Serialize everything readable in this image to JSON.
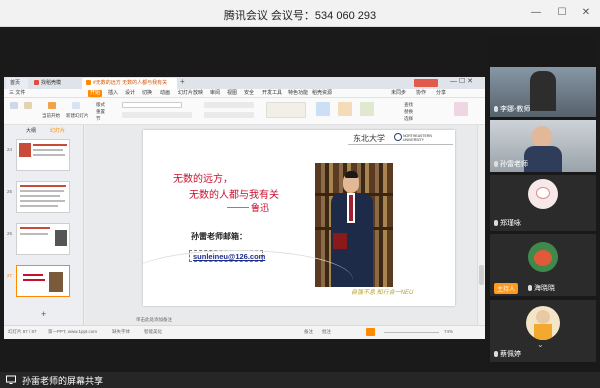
{
  "window": {
    "title": "腾讯会议 会议号：534 060 293",
    "minimize": "—",
    "maximize": "☐",
    "close": "✕"
  },
  "wps": {
    "tabs": [
      {
        "label": "首页",
        "color": "#4a74e6"
      },
      {
        "label": "找稻壳模板",
        "color": "#e24c3f"
      },
      {
        "label": "#无数的远方 无数的人都与我有关#...",
        "color": "#ff8a00"
      }
    ],
    "menus": [
      "三 文件",
      "开始",
      "插入",
      "设计",
      "切换",
      "动画",
      "幻灯片放映",
      "审阅",
      "视图",
      "安全",
      "开发工具",
      "特色功能",
      "稻壳资源"
    ],
    "active_menu": "开始",
    "right_menu": [
      "未同步",
      "协作",
      "分享"
    ],
    "ribbon": [
      "当前开始",
      "新建幻灯片",
      "版式",
      "重置",
      "节",
      "从当前开始",
      "段落",
      "绘图",
      "排列",
      "查找",
      "替换",
      "选择"
    ],
    "panel_tabs": [
      "大纲",
      "幻灯片"
    ],
    "slides": [
      {
        "num": "24"
      },
      {
        "num": "25"
      },
      {
        "num": "26"
      },
      {
        "num": "27"
      }
    ],
    "add_note": "单击此处添加备注",
    "status": {
      "slide_info": "幻灯片 87 / 87",
      "theme": "第一PPT, www.1ppt.com",
      "missing_font": "缺失字体",
      "smart_beautify": "智能美化",
      "notes": "备注",
      "comments": "批注",
      "zoom": "74%"
    }
  },
  "slide": {
    "university": "东北大学",
    "university_en_1": "NORTHEASTERN",
    "university_en_2": "UNIVERSITY",
    "line1": "无数的远方，",
    "line2": "无数的人都与我有关",
    "author": "鲁迅",
    "email_label": "孙雷老师邮箱：",
    "email": "sunleineu@126.com",
    "signature": "自强不息 知行合一NEU"
  },
  "participants": [
    {
      "name": "李娜-教师",
      "type": "video"
    },
    {
      "name": "孙雷老师",
      "type": "video"
    },
    {
      "name": "郑瑾咏",
      "type": "avatar"
    },
    {
      "name": "海晓晓",
      "type": "avatar",
      "host": "主持人"
    },
    {
      "name": "蔡佩婷",
      "type": "avatar"
    }
  ],
  "sharing": {
    "text": "孙雷老师的屏幕共享"
  }
}
